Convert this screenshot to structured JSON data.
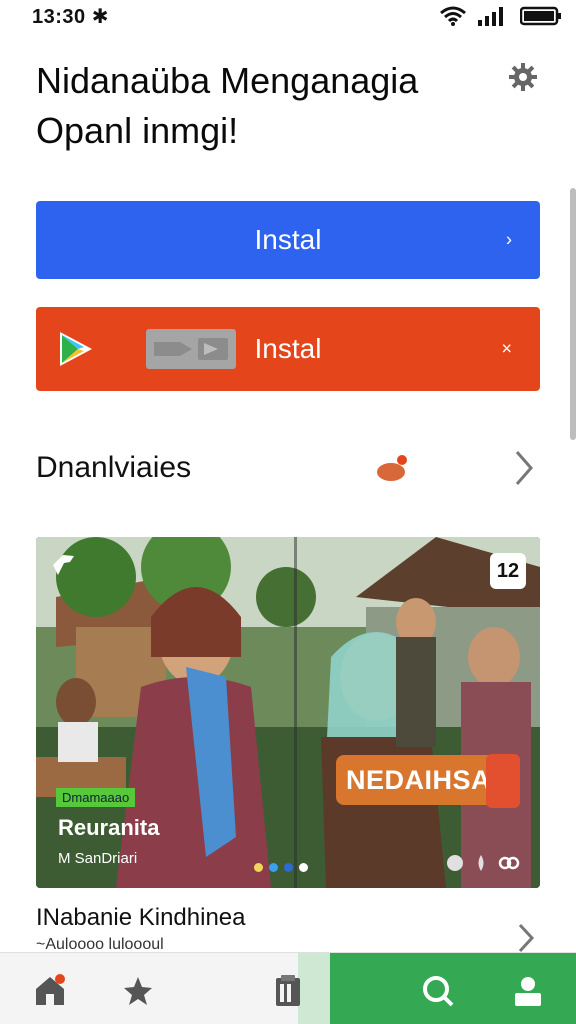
{
  "status_bar": {
    "time": "13:30 ✱"
  },
  "header": {
    "title": "Nidanaüba Menganagia Opanl inmgi!"
  },
  "buttons": {
    "blue": {
      "label": "Instal",
      "chevron": "›"
    },
    "red": {
      "label": "Instal",
      "chevron": "×"
    }
  },
  "section": {
    "title": "Dnanlviaies"
  },
  "card": {
    "tag": "Dmamaaao",
    "title": "Reuranita",
    "subtitle": "M SanDriari",
    "overlay_brand": "NEDAIHSA",
    "badge": "12"
  },
  "list_item": {
    "title": "INabanie Kindhinea",
    "subtitle": "~Auloooo luloooul"
  },
  "colors": {
    "blue": "#2d63ef",
    "red": "#e5451a",
    "green": "#34a853"
  },
  "icons": [
    "settings-gear-icon",
    "play-store-icon",
    "video-icon",
    "notification-icon",
    "pin-icon",
    "badge-icon",
    "home-icon",
    "pin-star-icon",
    "clipboard-icon",
    "search-icon",
    "profile-icon"
  ]
}
